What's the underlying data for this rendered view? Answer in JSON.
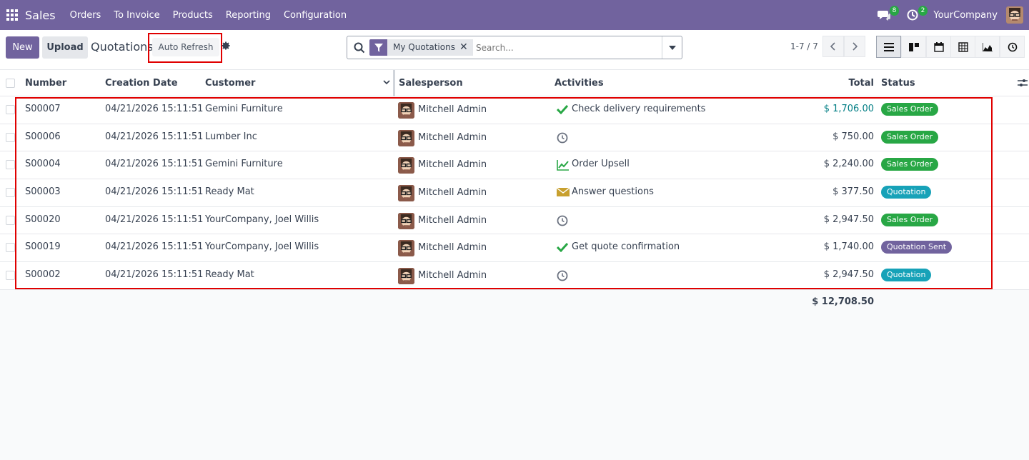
{
  "app": {
    "name": "Sales"
  },
  "menu": [
    "Orders",
    "To Invoice",
    "Products",
    "Reporting",
    "Configuration"
  ],
  "systray": {
    "messages_count": "8",
    "activities_count": "2",
    "company": "YourCompany"
  },
  "toolbar": {
    "new_label": "New",
    "upload_label": "Upload",
    "breadcrumb": "Quotations",
    "auto_refresh_label": "Auto Refresh"
  },
  "search": {
    "facet": "My Quotations",
    "placeholder": "Search..."
  },
  "pager": {
    "text": "1-7 / 7"
  },
  "columns": {
    "number": "Number",
    "creation_date": "Creation Date",
    "customer": "Customer",
    "salesperson": "Salesperson",
    "activities": "Activities",
    "total": "Total",
    "status": "Status"
  },
  "rows": [
    {
      "number": "S00007",
      "date": "04/21/2026 15:11:51",
      "customer": "Gemini Furniture",
      "salesperson": "Mitchell Admin",
      "activity_icon": "check-icon",
      "activity": "Check delivery requirements",
      "total": "$ 1,706.00",
      "total_link": true,
      "status": "Sales Order",
      "status_color": "#28a745"
    },
    {
      "number": "S00006",
      "date": "04/21/2026 15:11:51",
      "customer": "Lumber Inc",
      "salesperson": "Mitchell Admin",
      "activity_icon": "clock-icon",
      "activity": "",
      "total": "$ 750.00",
      "total_link": false,
      "status": "Sales Order",
      "status_color": "#28a745"
    },
    {
      "number": "S00004",
      "date": "04/21/2026 15:11:51",
      "customer": "Gemini Furniture",
      "salesperson": "Mitchell Admin",
      "activity_icon": "chart-line-icon",
      "activity": "Order Upsell",
      "total": "$ 2,240.00",
      "total_link": false,
      "status": "Sales Order",
      "status_color": "#28a745"
    },
    {
      "number": "S00003",
      "date": "04/21/2026 15:11:51",
      "customer": "Ready Mat",
      "salesperson": "Mitchell Admin",
      "activity_icon": "envelope-icon",
      "activity": "Answer questions",
      "total": "$ 377.50",
      "total_link": false,
      "status": "Quotation",
      "status_color": "#17a2b8"
    },
    {
      "number": "S00020",
      "date": "04/21/2026 15:11:51",
      "customer": "YourCompany, Joel Willis",
      "salesperson": "Mitchell Admin",
      "activity_icon": "clock-icon",
      "activity": "",
      "total": "$ 2,947.50",
      "total_link": false,
      "status": "Sales Order",
      "status_color": "#28a745"
    },
    {
      "number": "S00019",
      "date": "04/21/2026 15:11:51",
      "customer": "YourCompany, Joel Willis",
      "salesperson": "Mitchell Admin",
      "activity_icon": "check-icon",
      "activity": "Get quote confirmation",
      "total": "$ 1,740.00",
      "total_link": false,
      "status": "Quotation Sent",
      "status_color": "#71639e"
    },
    {
      "number": "S00002",
      "date": "04/21/2026 15:11:51",
      "customer": "Ready Mat",
      "salesperson": "Mitchell Admin",
      "activity_icon": "clock-icon",
      "activity": "",
      "total": "$ 2,947.50",
      "total_link": false,
      "status": "Quotation",
      "status_color": "#17a2b8"
    }
  ],
  "grand_total": "$ 12,708.50",
  "colors": {
    "brand": "#71639e",
    "highlight": "#e00000"
  }
}
